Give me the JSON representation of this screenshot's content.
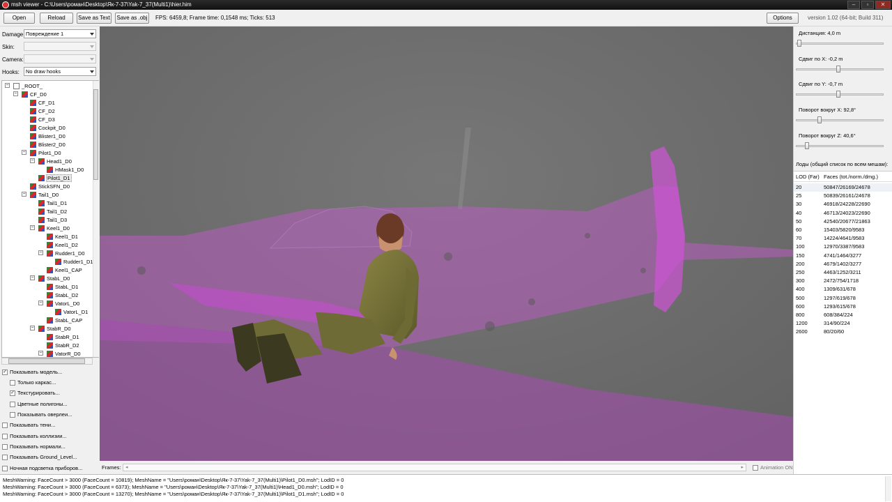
{
  "window": {
    "title": "msh viewer - C:\\Users\\роман\\Desktop\\Як-7-37\\Yak-7_37(Multi1)\\hier.him"
  },
  "toolbar": {
    "open": "Open",
    "reload": "Reload",
    "save_text": "Save as Text",
    "save_obj": "Save as .obj",
    "stats": "FPS: 6459,8; Frame time: 0,1548 ms; Ticks: 513",
    "options": "Options",
    "version": "version 1.02 (64-bit; Build 311)"
  },
  "left": {
    "damage_label": "Damage:",
    "damage_value": "Повреждение 1",
    "skin_label": "Skin:",
    "skin_value": "",
    "camera_label": "Camera:",
    "camera_value": "",
    "hooks_label": "Hooks:",
    "hooks_value": "No draw hooks"
  },
  "tree": {
    "nodes": [
      {
        "label": "_ROOT_"
      },
      {
        "label": "CF_D0"
      },
      {
        "label": "CF_D1"
      },
      {
        "label": "CF_D2"
      },
      {
        "label": "CF_D3"
      },
      {
        "label": "Cockpit_D0"
      },
      {
        "label": "Blister1_D0"
      },
      {
        "label": "Blister2_D0"
      },
      {
        "label": "Pilot1_D0"
      },
      {
        "label": "Head1_D0"
      },
      {
        "label": "HMask1_D0"
      },
      {
        "label": "Pilot1_D1"
      },
      {
        "label": "StickSFN_D0"
      },
      {
        "label": "Tail1_D0"
      },
      {
        "label": "Tail1_D1"
      },
      {
        "label": "Tail1_D2"
      },
      {
        "label": "Tail1_D3"
      },
      {
        "label": "Keel1_D0"
      },
      {
        "label": "Keel1_D1"
      },
      {
        "label": "Keel1_D2"
      },
      {
        "label": "Rudder1_D0"
      },
      {
        "label": "Rudder1_D1"
      },
      {
        "label": "Keel1_CAP"
      },
      {
        "label": "StabL_D0"
      },
      {
        "label": "StabL_D1"
      },
      {
        "label": "StabL_D2"
      },
      {
        "label": "VatorL_D0"
      },
      {
        "label": "VatorL_D1"
      },
      {
        "label": "StabL_CAP"
      },
      {
        "label": "StabR_D0"
      },
      {
        "label": "StabR_D1"
      },
      {
        "label": "StabR_D2"
      },
      {
        "label": "VatorR_D0"
      }
    ]
  },
  "options": [
    {
      "label": "Показывать модель...",
      "checked": true
    },
    {
      "label": "Только каркас...",
      "checked": false
    },
    {
      "label": "Текстурировать...",
      "checked": true
    },
    {
      "label": "Цветные полигоны...",
      "checked": false
    },
    {
      "label": "Показывать оверлеи...",
      "checked": false
    },
    {
      "label": "Показывать тени...",
      "checked": false
    },
    {
      "label": "Показывать коллизии...",
      "checked": false
    },
    {
      "label": "Показывать нормали...",
      "checked": false
    },
    {
      "label": "Показывать Ground_Level...",
      "checked": false
    },
    {
      "label": "Ночная подсветка приборов...",
      "checked": false
    }
  ],
  "frames": {
    "label": "Frames:",
    "animation": "Animation ON",
    "animation_checked": false
  },
  "right": {
    "sliders": [
      {
        "label": "Дистанция:",
        "value": "4,0 m",
        "level": 0.02
      },
      {
        "label": "Сдвиг по X:",
        "value": "-0,2 m",
        "level": 0.48
      },
      {
        "label": "Сдвиг по Y:",
        "value": "-0,7 m",
        "level": 0.48
      },
      {
        "label": "Поворот вокруг X:",
        "value": "92,8°",
        "level": 0.26
      },
      {
        "label": "Поворот вокруг Z:",
        "value": "40,6°",
        "level": 0.11
      }
    ],
    "lods_title": "Лоды (общий список по всем мешам):",
    "col_lod": "LOD (Far)",
    "col_faces": "Faces (tot./norm./dmg.)",
    "lods": [
      {
        "lod": "20",
        "faces": "50847/26169/24678"
      },
      {
        "lod": "25",
        "faces": "50839/26161/24678"
      },
      {
        "lod": "30",
        "faces": "46918/24228/22690"
      },
      {
        "lod": "40",
        "faces": "46713/24023/22690"
      },
      {
        "lod": "50",
        "faces": "42540/20677/21863"
      },
      {
        "lod": "60",
        "faces": "15403/5820/9583"
      },
      {
        "lod": "70",
        "faces": "14224/4641/9583"
      },
      {
        "lod": "100",
        "faces": "12970/3387/9583"
      },
      {
        "lod": "150",
        "faces": "4741/1464/3277"
      },
      {
        "lod": "200",
        "faces": "4679/1402/3277"
      },
      {
        "lod": "250",
        "faces": "4463/1252/3211"
      },
      {
        "lod": "300",
        "faces": "2472/754/1718"
      },
      {
        "lod": "400",
        "faces": "1309/631/678"
      },
      {
        "lod": "500",
        "faces": "1297/619/678"
      },
      {
        "lod": "600",
        "faces": "1293/615/678"
      },
      {
        "lod": "800",
        "faces": "608/384/224"
      },
      {
        "lod": "1200",
        "faces": "314/90/224"
      },
      {
        "lod": "2600",
        "faces": "80/20/60"
      }
    ]
  },
  "console": {
    "lines": [
      "MeshWarning: FaceCount > 3000 (FaceCount = 10819); MeshName = \"Users\\роман\\Desktop\\Як-7-37\\Yak-7_37(Multi1)\\Pilot1_D0.msh\"; LodID = 0",
      "MeshWarning: FaceCount > 3000 (FaceCount = 6373); MeshName = \"Users\\роман\\Desktop\\Як-7-37\\Yak-7_37(Multi1)\\Head1_D0.msh\"; LodID = 0",
      "MeshWarning: FaceCount > 3000 (FaceCount = 13270); MeshName = \"Users\\роман\\Desktop\\Як-7-37\\Yak-7_37(Multi1)\\Pilot1_D1.msh\"; LodID = 0"
    ]
  },
  "colors": {
    "accent_magenta": "#c040c8",
    "viewport_bg": "#6d6d6d"
  }
}
